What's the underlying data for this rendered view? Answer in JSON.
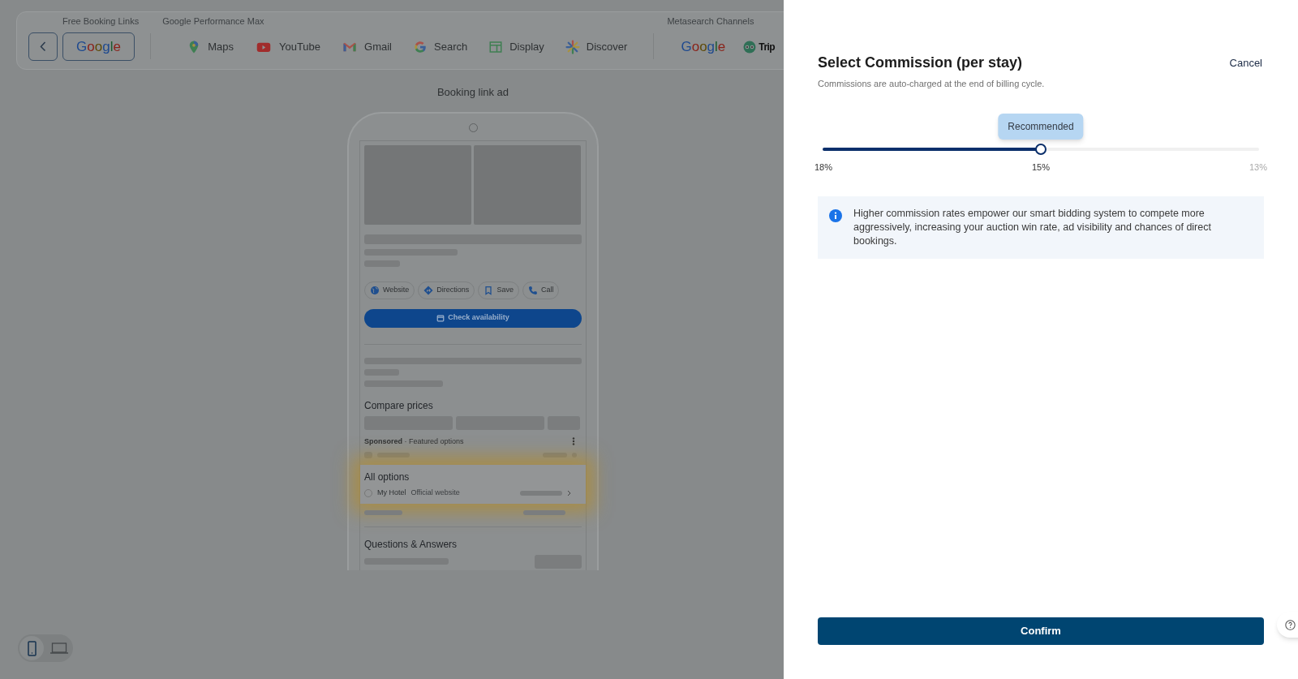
{
  "channel_bar": {
    "sections": [
      {
        "heading": "Free Booking Links",
        "items": [
          {
            "label": "Google",
            "kind": "logo",
            "selected": true
          }
        ]
      },
      {
        "heading": "Google Performance Max",
        "items": [
          {
            "label": "Maps",
            "kind": "maps",
            "selected": false
          },
          {
            "label": "YouTube",
            "kind": "youtube",
            "selected": false
          },
          {
            "label": "Gmail",
            "kind": "gmail",
            "selected": false
          },
          {
            "label": "Search",
            "kind": "search",
            "selected": false
          },
          {
            "label": "Display",
            "kind": "display",
            "selected": false
          },
          {
            "label": "Discover",
            "kind": "discover",
            "selected": false
          }
        ]
      },
      {
        "heading": "Metasearch Channels",
        "items": [
          {
            "label": "Google",
            "kind": "logo",
            "selected": false
          },
          {
            "label": "Trip",
            "kind": "trip",
            "selected": false
          }
        ]
      }
    ]
  },
  "preview": {
    "title": "Booking link ad",
    "actions": [
      {
        "label": "Website",
        "kind": "globe"
      },
      {
        "label": "Directions",
        "kind": "directions"
      },
      {
        "label": "Save",
        "kind": "bookmark"
      },
      {
        "label": "Call",
        "kind": "phone"
      }
    ],
    "cta": "Check availability",
    "compare_heading": "Compare prices",
    "sponsored": "**Sponsored** · Featured options",
    "all_options": {
      "heading": "All options",
      "hotel": "My Hotel",
      "source": "Official website"
    },
    "qa_heading": "Questions & Answers"
  },
  "devices": [
    {
      "kind": "phone",
      "selected": true
    },
    {
      "kind": "laptop",
      "selected": false
    }
  ],
  "panel": {
    "title": "Select Commission (per stay)",
    "subtitle": "Commissions are auto-charged at the end of billing cycle.",
    "cancel": "Cancel",
    "slider": {
      "level": 0.5,
      "tooltip": "Recommended",
      "ticks": [
        {
          "label": "18%",
          "muted": false
        },
        {
          "label": "15%",
          "muted": false
        },
        {
          "label": "13%",
          "muted": true
        }
      ]
    },
    "info": "Higher commission rates empower our smart bidding system to compete more aggressively, increasing your auction win rate, ad visibility and chances of direct bookings.",
    "confirm": "Confirm"
  }
}
